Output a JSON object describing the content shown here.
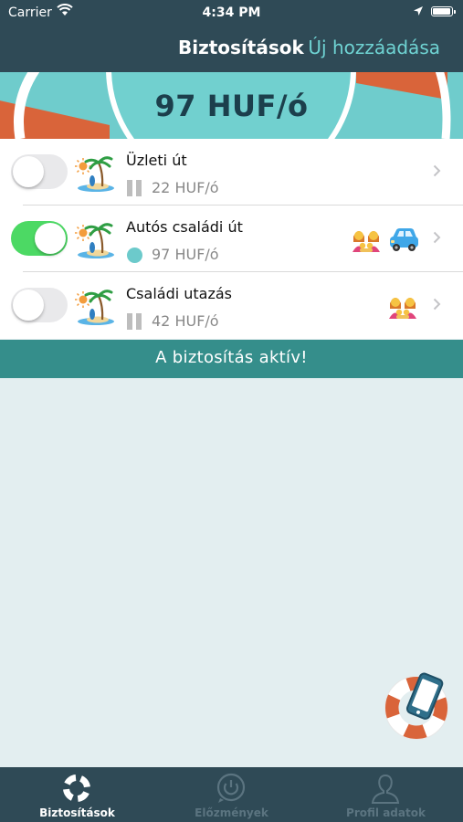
{
  "status_bar": {
    "carrier": "Carrier",
    "time": "4:34 PM"
  },
  "nav": {
    "title": "Biztosítások",
    "add_label": "Új hozzáadása"
  },
  "hero": {
    "price": "97 HUF/ó"
  },
  "insurances": [
    {
      "name": "Üzleti út",
      "price": "22 HUF/ó",
      "enabled": false,
      "status": "paused",
      "badges": []
    },
    {
      "name": "Autós családi út",
      "price": "97 HUF/ó",
      "enabled": true,
      "status": "active",
      "badges": [
        "family",
        "car"
      ]
    },
    {
      "name": "Családi utazás",
      "price": "42 HUF/ó",
      "enabled": false,
      "status": "paused",
      "badges": [
        "family"
      ]
    }
  ],
  "banner": {
    "text": "A biztosítás aktív!"
  },
  "tabs": [
    {
      "label": "Biztosítások",
      "icon": "lifebuoy-icon",
      "active": true
    },
    {
      "label": "Előzmények",
      "icon": "history-icon",
      "active": false
    },
    {
      "label": "Profil adatok",
      "icon": "profile-icon",
      "active": false
    }
  ],
  "colors": {
    "header": "#2f4a56",
    "accent": "#6fcccc",
    "banner": "#358e8b",
    "toggle_on": "#4cd964",
    "lifebuoy_red": "#d9643a"
  }
}
